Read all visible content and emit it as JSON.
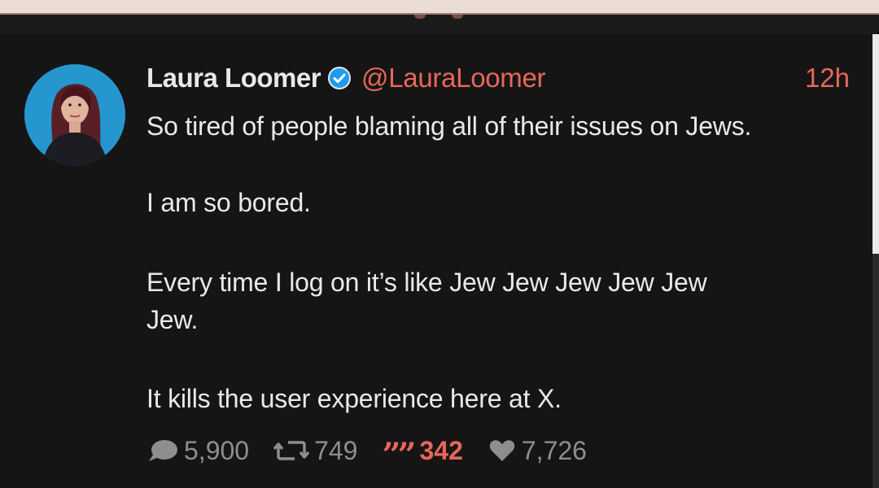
{
  "post": {
    "author": {
      "display_name": "Laura Loomer",
      "handle": "@LauraLoomer",
      "verified": true
    },
    "timestamp": "12h",
    "lines": [
      "So tired of people blaming all of their issues on Jews.",
      "I am so bored.",
      "Every time I log on it’s like Jew Jew Jew Jew Jew",
      "Jew.",
      "It kills the user experience here at X."
    ],
    "stats": {
      "replies": "5,900",
      "reposts": "749",
      "quotes": "342",
      "likes": "7,726"
    }
  },
  "icons": {
    "verified": "verified-badge-icon",
    "reply": "comment-bubble-icon",
    "repost": "repost-arrows-icon",
    "quote": "quote-marks-icon",
    "like": "heart-icon"
  },
  "colors": {
    "background": "#151515",
    "text": "#e9e9e9",
    "accent": "#e8665a",
    "muted": "#8e8e8e",
    "verified": "#1d9bf0"
  }
}
